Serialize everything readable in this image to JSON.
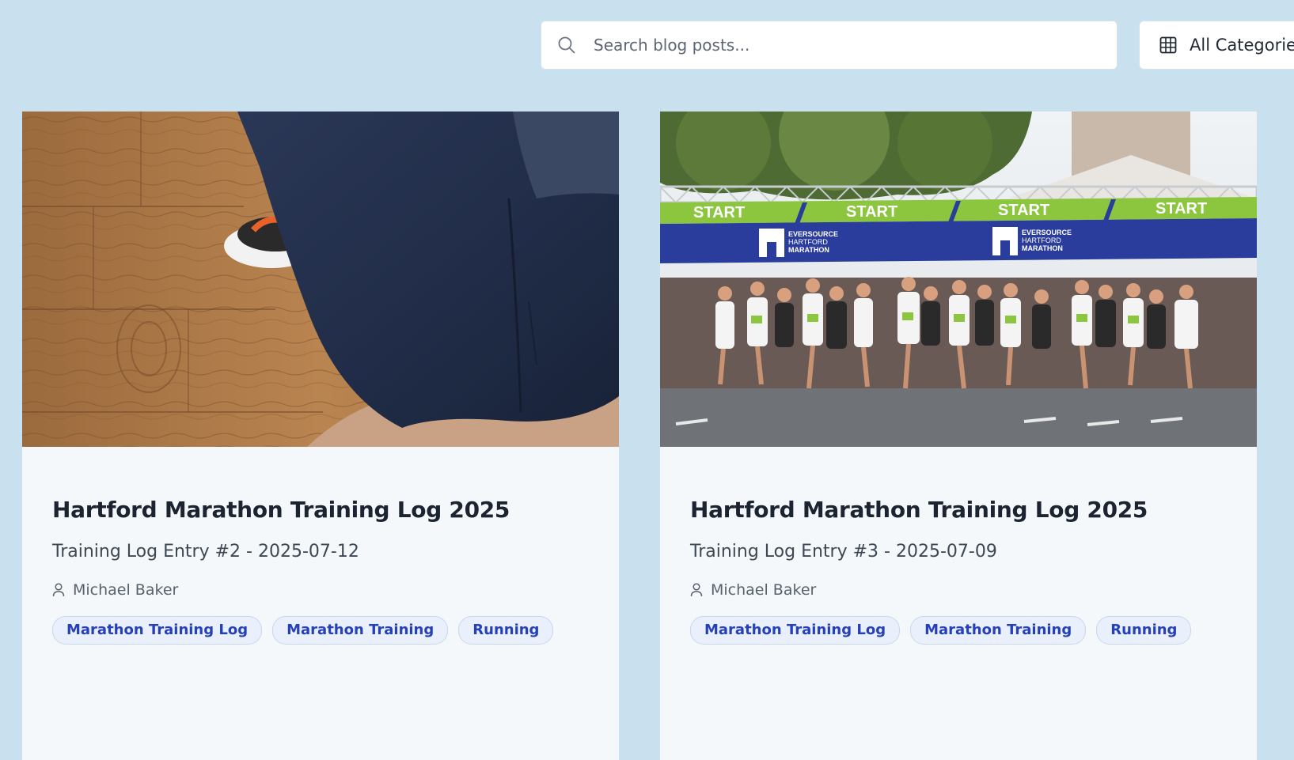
{
  "search": {
    "placeholder": "Search blog posts...",
    "icon": "search-icon"
  },
  "category_filter": {
    "label": "All Categories",
    "icon": "grid-icon"
  },
  "posts": [
    {
      "title": "Hartford Marathon Training Log 2025",
      "subtitle": "Training Log Entry #2 - 2025-07-12",
      "author": "Michael Baker",
      "tags": [
        "Marathon Training Log",
        "Marathon Training",
        "Running"
      ],
      "image": "hardwood-floor-and-navy-shorts-photo"
    },
    {
      "title": "Hartford Marathon Training Log 2025",
      "subtitle": "Training Log Entry #3 - 2025-07-09",
      "author": "Michael Baker",
      "tags": [
        "Marathon Training Log",
        "Marathon Training",
        "Running"
      ],
      "image": "marathon-start-line-photo",
      "image_text": {
        "start": "START",
        "logo_line1": "EVERSOURCE",
        "logo_line2": "HARTFORD",
        "logo_line3": "MARATHON"
      }
    }
  ],
  "colors": {
    "page_background": "#c9e0ee",
    "card_background": "#f4f8fb",
    "tag_text": "#2540b8",
    "tag_background": "#e9f0fb"
  }
}
